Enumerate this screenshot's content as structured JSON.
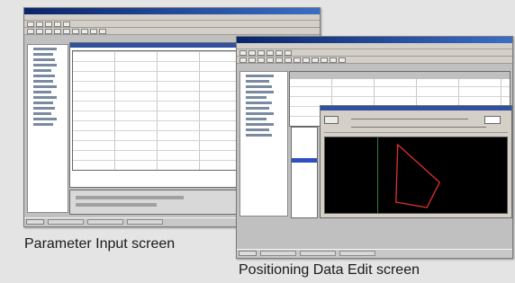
{
  "captions": {
    "param": "Parameter Input screen",
    "pos": "Positioning Data Edit screen"
  },
  "colors": {
    "title_bar": "#0a246a",
    "plot_background": "#000000",
    "trace_line": "#e03030"
  },
  "screens": {
    "param": {
      "rows": 11,
      "columns": 5
    },
    "pos": {
      "rows": 10,
      "columns": 8
    }
  }
}
